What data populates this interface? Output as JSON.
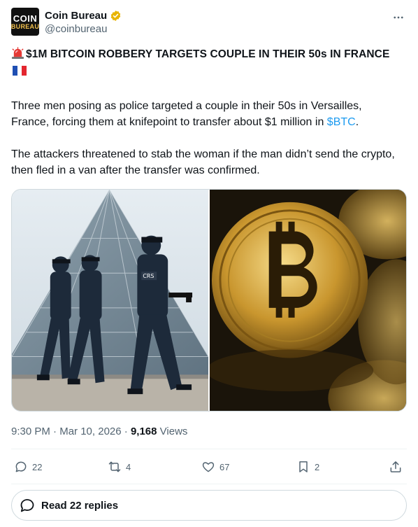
{
  "author": {
    "avatar_line1": "COIN",
    "avatar_line2": "BUREAU",
    "display_name": "Coin Bureau",
    "handle": "@coinbureau",
    "verified_icon": "gold-verified-badge-icon"
  },
  "tweet": {
    "headline_icon": "police-siren-emoji",
    "headline": "$1M BITCOIN ROBBERY TARGETS COUPLE IN THEIR 50s IN FRANCE",
    "headline_flag": "france-flag-emoji",
    "paragraph1_before": "Three men posing as police targeted a couple in their 50s in Versailles, France, forcing them at knifepoint to transfer about $1 million in ",
    "cashtag": "$BTC",
    "paragraph1_after": ".",
    "paragraph2": "The attackers threatened to stab the woman if the man didn’t send the crypto, then fled in a van after the transfer was confirmed.",
    "images": [
      {
        "subject": "police-officers-louvre-photo"
      },
      {
        "subject": "bitcoin-coins-photo"
      }
    ],
    "officer_patch": "CRS"
  },
  "meta": {
    "time": "9:30 PM",
    "separator": "·",
    "date": "Mar 10, 2026",
    "views_count": "9,168",
    "views_label": "Views"
  },
  "actions": {
    "replies": "22",
    "reposts": "4",
    "likes": "67",
    "bookmarks": "2"
  },
  "read_replies_label": "Read 22 replies",
  "colors": {
    "link": "#1d9bf0",
    "muted": "#536471",
    "text": "#0f1419",
    "verified": "#e8b400"
  }
}
